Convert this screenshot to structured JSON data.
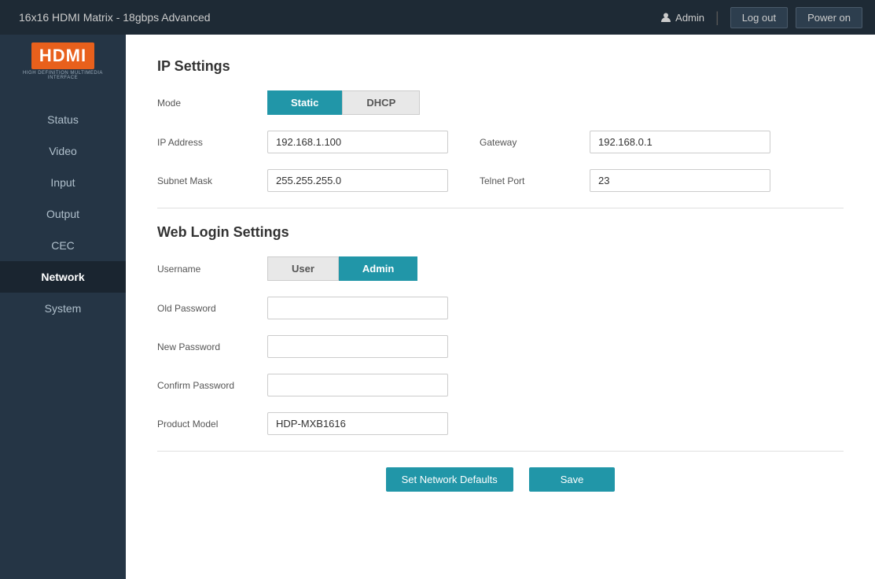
{
  "topbar": {
    "title": "16x16 HDMI Matrix - 18gbps Advanced",
    "user": "Admin",
    "logout_label": "Log out",
    "poweron_label": "Power on"
  },
  "sidebar": {
    "logo_text": "HDMI",
    "logo_subtitle": "HIGH DEFINITION MULTIMEDIA INTERFACE",
    "items": [
      {
        "id": "status",
        "label": "Status",
        "active": false
      },
      {
        "id": "video",
        "label": "Video",
        "active": false
      },
      {
        "id": "input",
        "label": "Input",
        "active": false
      },
      {
        "id": "output",
        "label": "Output",
        "active": false
      },
      {
        "id": "cec",
        "label": "CEC",
        "active": false
      },
      {
        "id": "network",
        "label": "Network",
        "active": true
      },
      {
        "id": "system",
        "label": "System",
        "active": false
      }
    ]
  },
  "ip_settings": {
    "section_title": "IP Settings",
    "mode_label": "Mode",
    "static_label": "Static",
    "dhcp_label": "DHCP",
    "ip_address_label": "IP Address",
    "ip_address_value": "192.168.1.100",
    "gateway_label": "Gateway",
    "gateway_value": "192.168.0.1",
    "subnet_mask_label": "Subnet Mask",
    "subnet_mask_value": "255.255.255.0",
    "telnet_port_label": "Telnet Port",
    "telnet_port_value": "23"
  },
  "web_login_settings": {
    "section_title": "Web Login Settings",
    "username_label": "Username",
    "user_label": "User",
    "admin_label": "Admin",
    "old_password_label": "Old Password",
    "old_password_value": "",
    "new_password_label": "New Password",
    "new_password_value": "",
    "confirm_password_label": "Confirm Password",
    "confirm_password_value": "",
    "product_model_label": "Product Model",
    "product_model_value": "HDP-MXB1616"
  },
  "actions": {
    "set_defaults_label": "Set Network Defaults",
    "save_label": "Save"
  }
}
